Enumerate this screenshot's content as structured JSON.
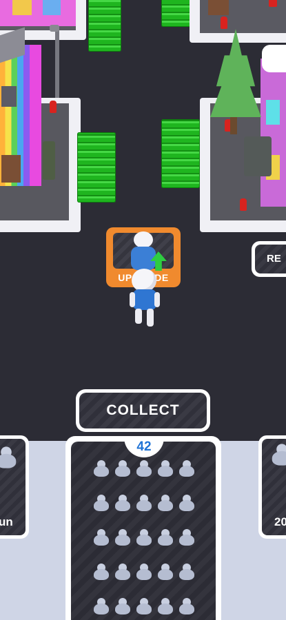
{
  "upgrade_pad": {
    "label": "UPGRADE"
  },
  "right_button": {
    "label": "RE"
  },
  "collect": {
    "label": "COLLECT"
  },
  "crowd": {
    "count": "42"
  },
  "left_station": {
    "label": "un"
  },
  "right_station": {
    "label": "20"
  },
  "colors": {
    "road": "#2c2c35",
    "cash": "#1fb51f",
    "upgrade_pad": "#f08a2e",
    "count_text": "#1f73d6",
    "player_shirt": "#2f76d2"
  },
  "icons": [
    "upgrade-arrow-icon",
    "crowd-person-icon",
    "fire-hydrant",
    "street-lamp"
  ]
}
